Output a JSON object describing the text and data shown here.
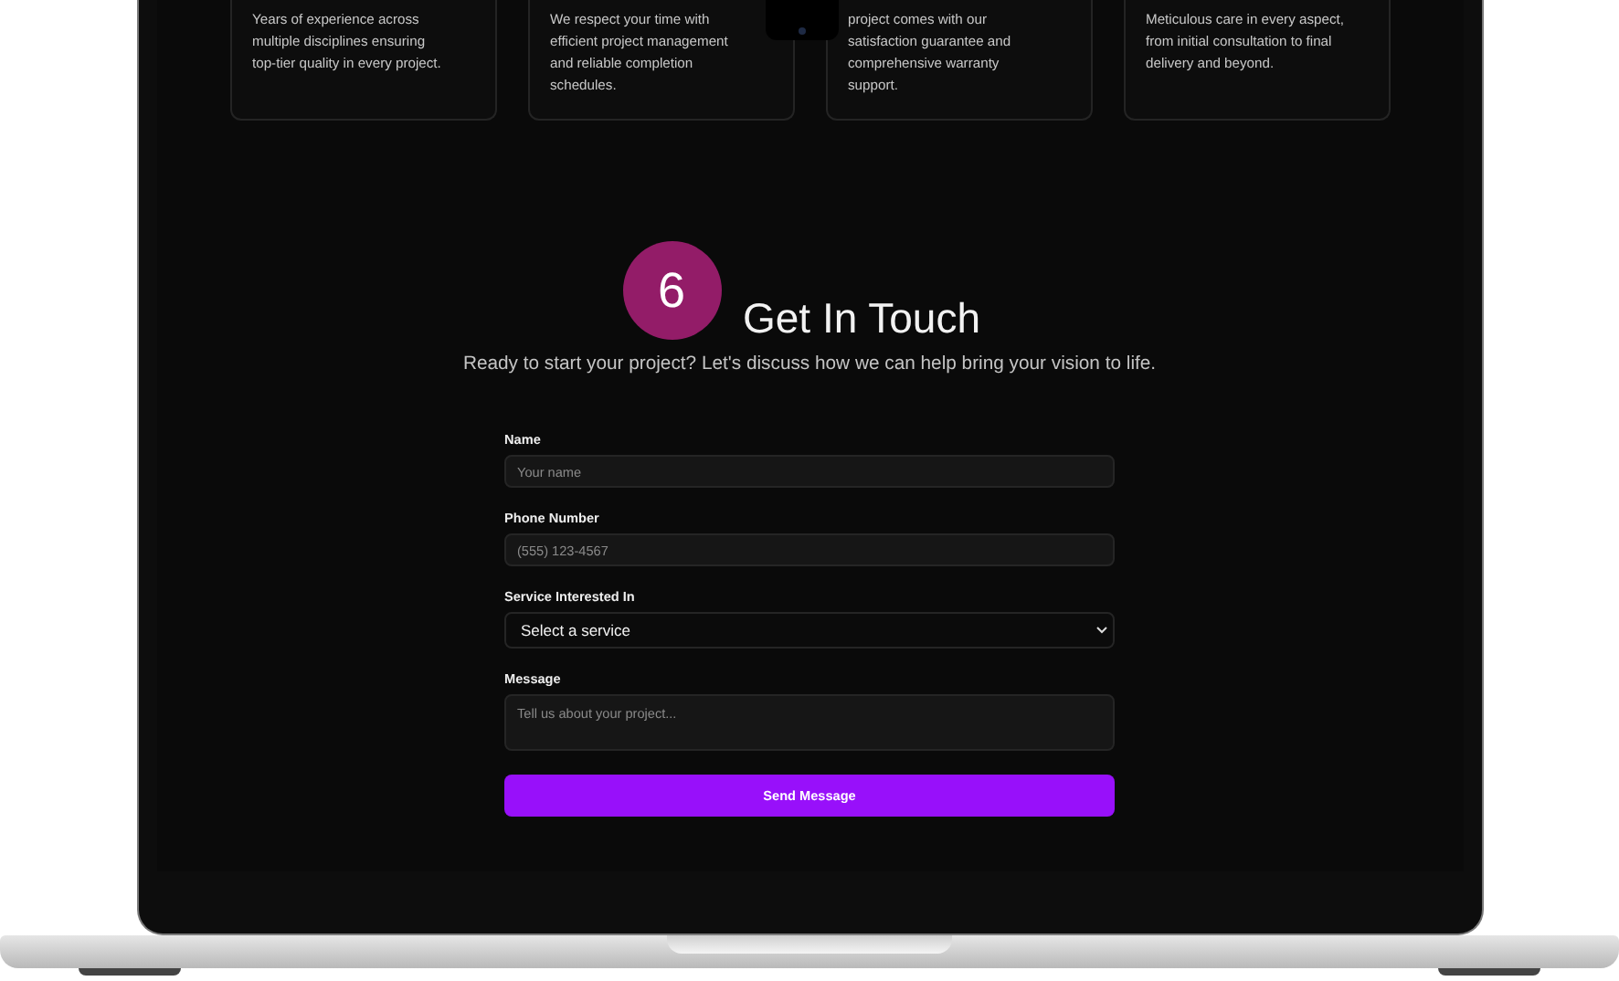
{
  "features": [
    {
      "lines": [
        "Years of experience across",
        "multiple disciplines ensuring",
        "top-tier quality in every project."
      ]
    },
    {
      "lines": [
        "We respect your time with",
        "efficient project management",
        "and reliable completion",
        "schedules."
      ]
    },
    {
      "lines": [
        "project comes with our",
        "satisfaction guarantee and",
        "comprehensive warranty",
        "support."
      ]
    },
    {
      "lines": [
        "Meticulous care in every aspect,",
        "from initial consultation to final",
        "delivery and beyond."
      ]
    }
  ],
  "section": {
    "number": "6",
    "title": "Get In Touch",
    "subtitle": "Ready to start your project? Let's discuss how we can help bring your vision to life."
  },
  "form": {
    "fields": [
      {
        "kind": "input",
        "label": "Name",
        "placeholder": "Your name"
      },
      {
        "kind": "input",
        "label": "Phone Number",
        "placeholder": "(555) 123-4567"
      },
      {
        "kind": "select",
        "label": "Service Interested In",
        "value": "Select a service"
      },
      {
        "kind": "textarea",
        "label": "Message",
        "placeholder": "Tell us about your project..."
      }
    ],
    "submit": "Send Message"
  }
}
